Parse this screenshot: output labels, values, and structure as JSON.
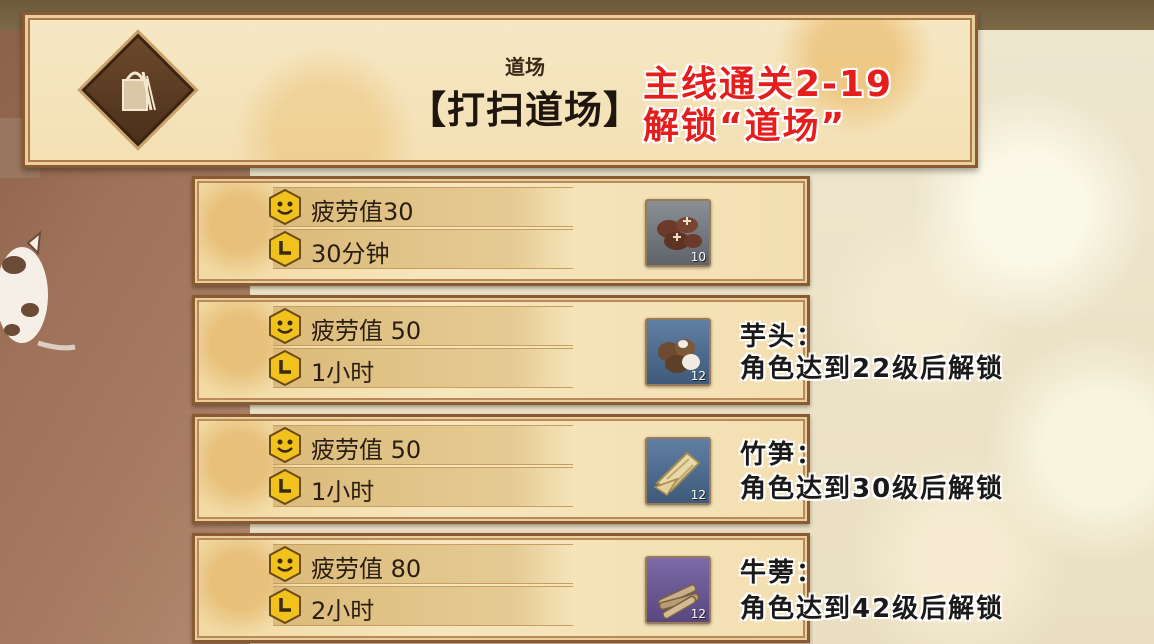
{
  "header": {
    "small_title": "道场",
    "main_title": "【打扫道场】",
    "note_line1": "主线通关2-19",
    "note_line2": "解锁“道场”",
    "icon": "bucket-icon"
  },
  "tasks": [
    {
      "fatigue_label": "疲劳值30",
      "time_label": "30分钟",
      "item_icon": "mushroom-icon",
      "item_count": "10",
      "unlock_line1": "",
      "unlock_line2": ""
    },
    {
      "fatigue_label": "疲劳值 50",
      "time_label": "1小时",
      "item_icon": "taro-icon",
      "item_count": "12",
      "unlock_line1": "芋头：",
      "unlock_line2": "角色达到22级后解锁"
    },
    {
      "fatigue_label": "疲劳值 50",
      "time_label": "1小时",
      "item_icon": "bamboo-shoot-icon",
      "item_count": "12",
      "unlock_line1": "竹笋：",
      "unlock_line2": "角色达到30级后解锁"
    },
    {
      "fatigue_label": "疲劳值 80",
      "time_label": "2小时",
      "item_icon": "burdock-icon",
      "item_count": "12",
      "unlock_line1": "牛蒡：",
      "unlock_line2": "角色达到42级后解锁"
    }
  ],
  "colors": {
    "note_red": "#e51d1d",
    "frame_brown": "#8a5a33",
    "panel_gold": "#f3dfb2"
  }
}
